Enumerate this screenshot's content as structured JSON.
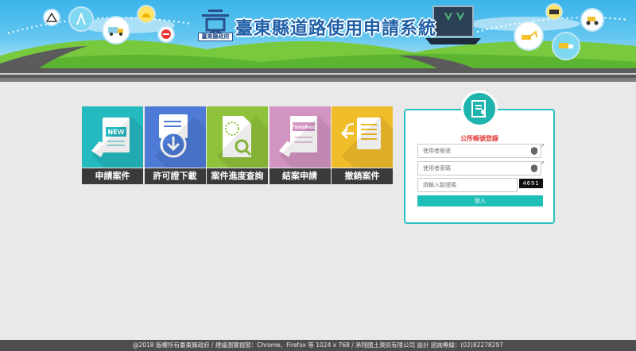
{
  "header": {
    "logo_caption": "臺東縣政府",
    "title": "臺東縣道路使用申請系統"
  },
  "menu": {
    "items": [
      {
        "label": "申請案件",
        "icon": "new-application-icon",
        "color": "#25b9c0",
        "badge": "NEW"
      },
      {
        "label": "許可證下載",
        "icon": "download-icon",
        "color": "#4e7bd6"
      },
      {
        "label": "案件進度查詢",
        "icon": "search-document-icon",
        "color": "#8fc23b"
      },
      {
        "label": "結案申請",
        "icon": "finished-icon",
        "color": "#d294c0",
        "badge": "Finished"
      },
      {
        "label": "撤銷案件",
        "icon": "revoke-document-icon",
        "color": "#f0bd2a"
      }
    ]
  },
  "login": {
    "title": "公所帳號登錄",
    "username_placeholder": "使用者帳號",
    "password_placeholder": "使用者密碼",
    "captcha_placeholder": "請輸入驗證碼",
    "captcha_code": "4691",
    "submit_label": "登入",
    "accent": "#1fbfb8"
  },
  "footer": {
    "text": "@2018 版權所有臺東縣政府 / 建議瀏覽視窗：Chrome、Firefox 等 1024 x 768 / 承翔國土資訊有限公司 設計 諮詢專線：(02)82278297"
  }
}
